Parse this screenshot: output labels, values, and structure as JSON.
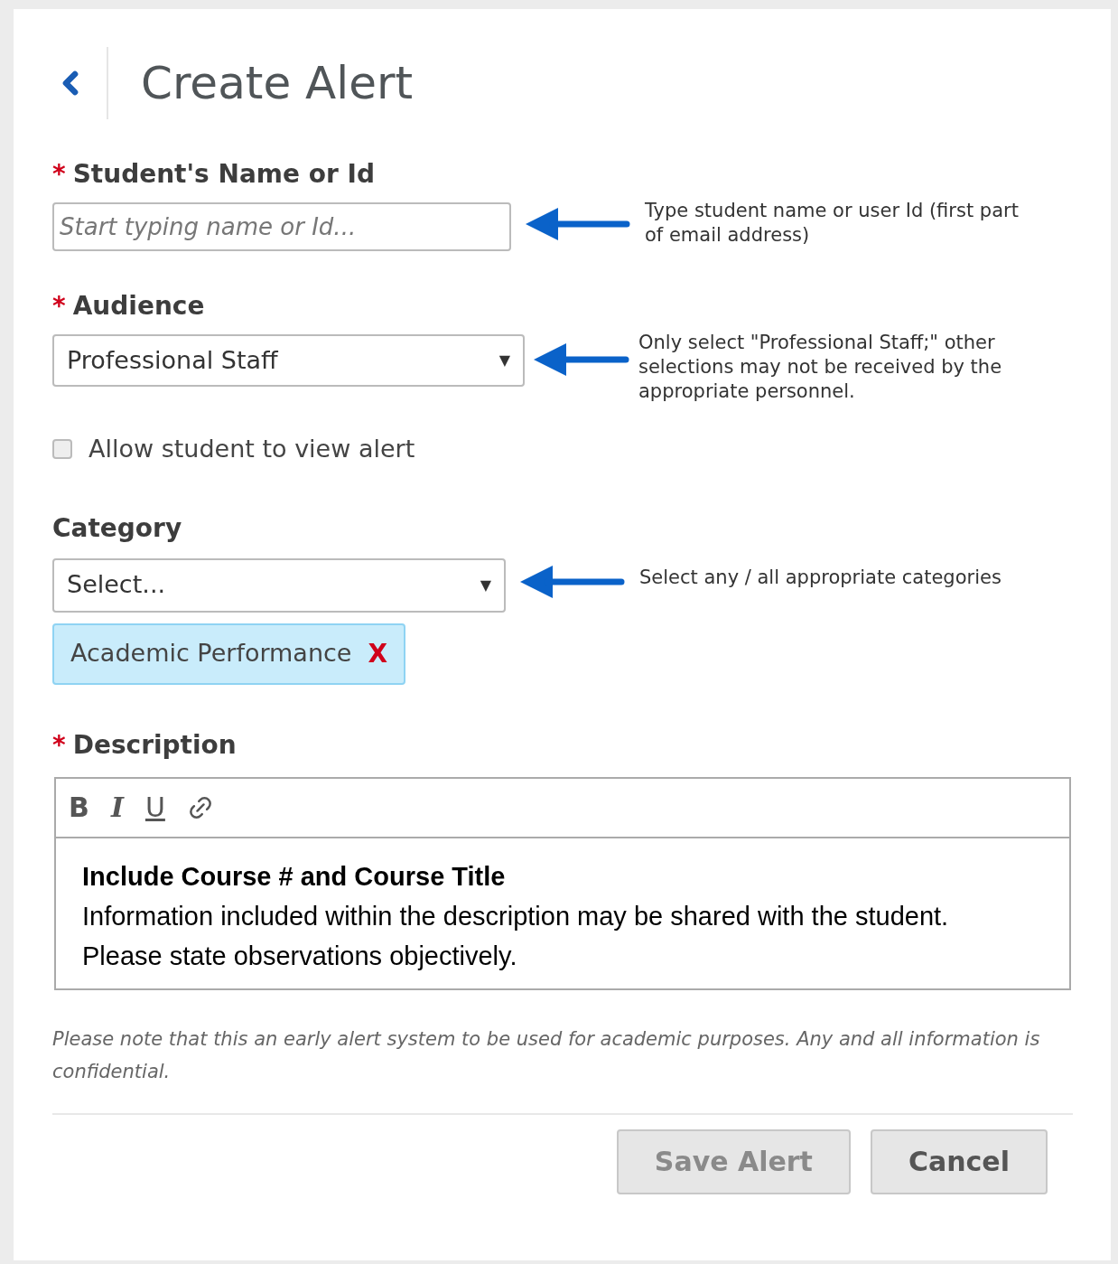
{
  "header": {
    "title": "Create Alert"
  },
  "student_field": {
    "required_mark": "*",
    "label": "Student's Name or Id",
    "placeholder": "Start typing name or Id...",
    "note": "Type student name or user Id (first part of email address)"
  },
  "audience_field": {
    "required_mark": "*",
    "label": "Audience",
    "value": "Professional Staff",
    "caret": "▼",
    "note": "Only select \"Professional Staff;\" other selections may not be received by the appropriate personnel."
  },
  "allow_view": {
    "label": "Allow student to view alert",
    "checked": false
  },
  "category_field": {
    "label": "Category",
    "value": "Select...",
    "caret": "▼",
    "note": "Select any / all appropriate categories",
    "tags": [
      {
        "label": "Academic Performance",
        "remove": "X"
      }
    ]
  },
  "description_field": {
    "required_mark": "*",
    "label": "Description",
    "toolbar": [
      {
        "kind": "bold",
        "label": "B"
      },
      {
        "kind": "italic",
        "label": "I"
      },
      {
        "kind": "underline",
        "label": "U"
      },
      {
        "kind": "link"
      }
    ],
    "heading": "Include Course # and Course Title",
    "lines": [
      "Information included within the description may be shared with the student.",
      "Please state observations objectively."
    ]
  },
  "disclaimer": "Please note that this an early alert system to be used for academic purposes. Any and all information is confidential.",
  "buttons": [
    {
      "label": "Save Alert",
      "disabled": true
    },
    {
      "label": "Cancel",
      "disabled": false
    }
  ]
}
